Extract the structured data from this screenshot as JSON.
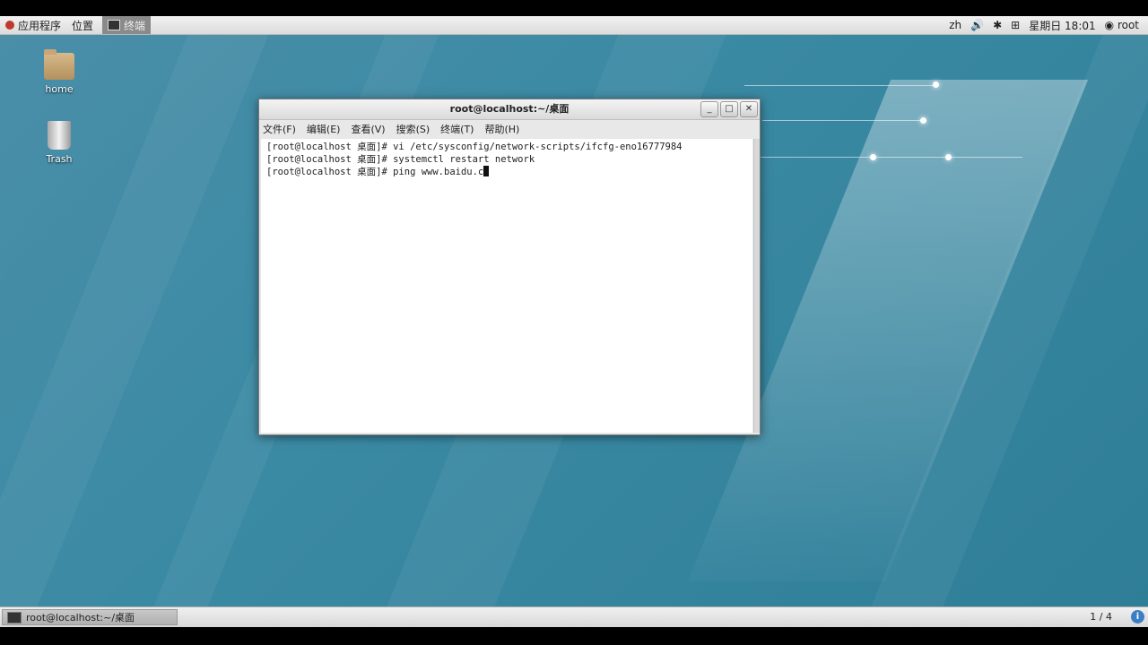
{
  "topbar": {
    "apps_label": "应用程序",
    "places_label": "位置",
    "task_label": "终端",
    "lang": "zh",
    "datetime": "星期日 18:01",
    "user": "root"
  },
  "desktop_icons": [
    {
      "label": "home"
    },
    {
      "label": "Trash"
    }
  ],
  "terminal": {
    "title": "root@localhost:~/桌面",
    "menu": [
      "文件(F)",
      "编辑(E)",
      "查看(V)",
      "搜索(S)",
      "终端(T)",
      "帮助(H)"
    ],
    "lines": [
      "[root@localhost 桌面]# vi /etc/sysconfig/network-scripts/ifcfg-eno16777984",
      "[root@localhost 桌面]# systemctl restart network",
      "[root@localhost 桌面]# ping www.baidu.c"
    ]
  },
  "taskbar": {
    "item_label": "root@localhost:~/桌面",
    "workspace": "1 / 4"
  }
}
